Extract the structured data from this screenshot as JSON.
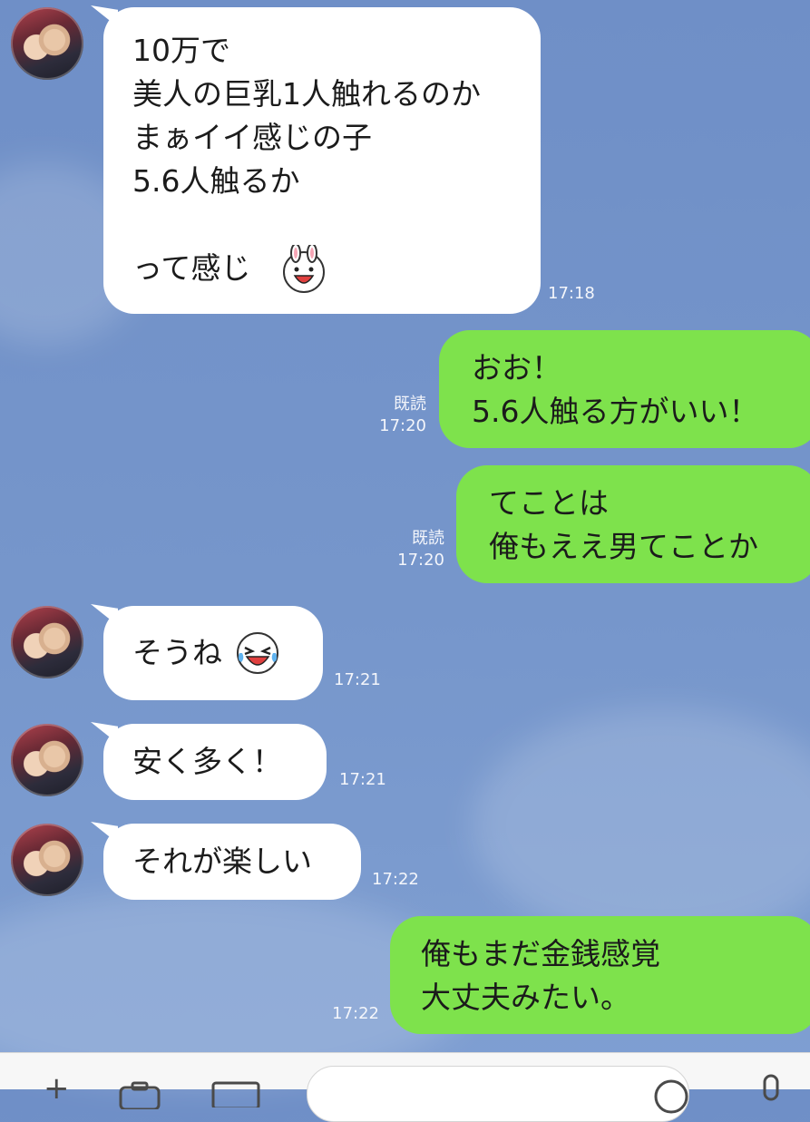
{
  "messages": [
    {
      "lines": "10万で\n美人の巨乳1人触れるのか\nまぁイイ感じの子\n5.6人触るか\n\nって感じ",
      "time": "17:18",
      "sticker": "bunny-face-icon"
    },
    {
      "lines": "おお！\n5.6人触る方がいい！",
      "read": "既読",
      "time": "17:20"
    },
    {
      "lines": "てことは\n俺もええ男てことか",
      "read": "既読",
      "time": "17:20"
    },
    {
      "lines": "そうね",
      "time": "17:21",
      "sticker": "laughing-crying-face-icon"
    },
    {
      "lines": "安く多く！",
      "time": "17:21"
    },
    {
      "lines": "それが楽しい",
      "time": "17:22"
    },
    {
      "lines": "俺もまだ金銭感覚\n大丈夫みたい。",
      "time": "17:22"
    }
  ],
  "colors": {
    "incoming": "#ffffff",
    "outgoing": "#7ee24c",
    "background": "#7696cb"
  },
  "composer": {
    "icons": [
      "plus-icon",
      "camera-icon",
      "image-icon",
      "smile-icon",
      "microphone-icon"
    ]
  }
}
